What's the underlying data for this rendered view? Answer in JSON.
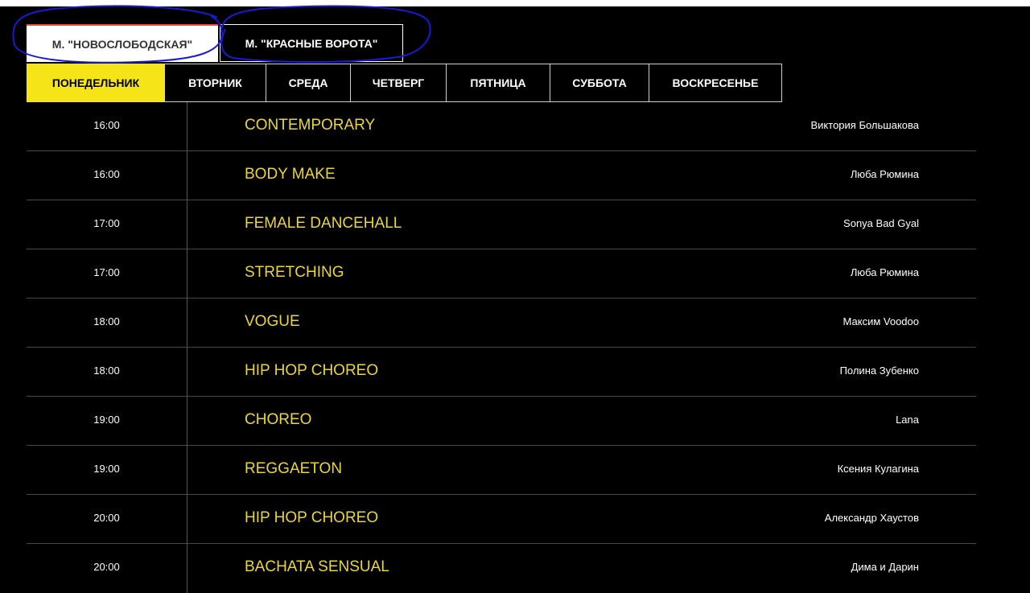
{
  "locations": [
    {
      "label": "М. \"НОВОСЛОБОДСКАЯ\"",
      "active": true
    },
    {
      "label": "М. \"КРАСНЫЕ ВОРОТА\"",
      "active": false
    }
  ],
  "days": [
    {
      "label": "ПОНЕДЕЛЬНИК",
      "active": true
    },
    {
      "label": "ВТОРНИК",
      "active": false
    },
    {
      "label": "СРЕДА",
      "active": false
    },
    {
      "label": "ЧЕТВЕРГ",
      "active": false
    },
    {
      "label": "ПЯТНИЦА",
      "active": false
    },
    {
      "label": "СУББОТА",
      "active": false
    },
    {
      "label": "ВОСКРЕСЕНЬЕ",
      "active": false
    }
  ],
  "schedule": [
    {
      "time": "16:00",
      "class": "CONTEMPORARY",
      "teacher": "Виктория Большакова"
    },
    {
      "time": "16:00",
      "class": "BODY MAKE",
      "teacher": "Люба Рюмина"
    },
    {
      "time": "17:00",
      "class": "FEMALE DANCEHALL",
      "teacher": "Sonya Bad Gyal"
    },
    {
      "time": "17:00",
      "class": "STRETCHING",
      "teacher": "Люба Рюмина"
    },
    {
      "time": "18:00",
      "class": "VOGUE",
      "teacher": "Максим Voodoo"
    },
    {
      "time": "18:00",
      "class": "HIP HOP CHOREO",
      "teacher": "Полина Зубенко"
    },
    {
      "time": "19:00",
      "class": "CHOREO",
      "teacher": "Lana"
    },
    {
      "time": "19:00",
      "class": "REGGAETON",
      "teacher": "Ксения Кулагина"
    },
    {
      "time": "20:00",
      "class": "HIP HOP CHOREO",
      "teacher": "Александр Хаустов"
    },
    {
      "time": "20:00",
      "class": "BACHATA SENSUAL",
      "teacher": "Дима и Дарин"
    }
  ],
  "colors": {
    "accent_yellow": "#f5e417",
    "class_text": "#ead737",
    "active_tab_border": "#e8512a",
    "annotation_blue": "#1a1ad6"
  }
}
